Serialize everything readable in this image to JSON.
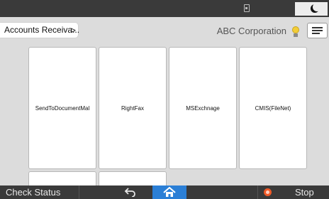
{
  "status_bar": {
    "icons": [
      "sd-card-icon",
      "night-mode-icon"
    ]
  },
  "header": {
    "breadcrumb": "Accounts Receiva...",
    "breadcrumb_chevron": ">",
    "company": "ABC Corporation",
    "icons": [
      "lightbulb-icon",
      "menu-icon"
    ]
  },
  "tiles": [
    {
      "label": "SendToDocumentMal"
    },
    {
      "label": "RightFax"
    },
    {
      "label": "MSExchnage"
    },
    {
      "label": "CMIS(FileNet)"
    },
    {
      "label": ""
    },
    {
      "label": ""
    }
  ],
  "bottom_bar": {
    "check_status": "Check Status",
    "stop": "Stop",
    "icons": [
      "back-icon",
      "home-icon",
      "stop-icon"
    ],
    "home_color": "#2b7fd6",
    "stop_color": "#f05a28"
  }
}
